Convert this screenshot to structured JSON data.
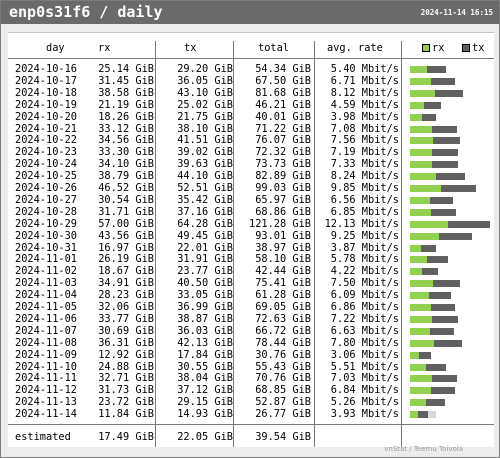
{
  "header": {
    "title": "enp0s31f6 / daily",
    "timestamp": "2024-11-14 16:15"
  },
  "columns": {
    "day": "day",
    "rx": "rx",
    "tx": "tx",
    "total": "total",
    "avg_rate": "avg. rate"
  },
  "legend": {
    "rx_label": "rx",
    "tx_label": "tx",
    "rx_icon": "green-square-icon",
    "tx_icon": "grey-square-icon"
  },
  "colors": {
    "rx": "#92d050",
    "tx": "#606060",
    "estimate": "#d8d8d8",
    "header": "#6a6a6a"
  },
  "rows": [
    {
      "day": "2024-10-16",
      "rx": "25.14 GiB",
      "tx": "29.20 GiB",
      "total": "54.34 GiB",
      "rate": "5.40 Mbit/s"
    },
    {
      "day": "2024-10-17",
      "rx": "31.45 GiB",
      "tx": "36.05 GiB",
      "total": "67.50 GiB",
      "rate": "6.71 Mbit/s"
    },
    {
      "day": "2024-10-18",
      "rx": "38.58 GiB",
      "tx": "43.10 GiB",
      "total": "81.68 GiB",
      "rate": "8.12 Mbit/s"
    },
    {
      "day": "2024-10-19",
      "rx": "21.19 GiB",
      "tx": "25.02 GiB",
      "total": "46.21 GiB",
      "rate": "4.59 Mbit/s"
    },
    {
      "day": "2024-10-20",
      "rx": "18.26 GiB",
      "tx": "21.75 GiB",
      "total": "40.01 GiB",
      "rate": "3.98 Mbit/s"
    },
    {
      "day": "2024-10-21",
      "rx": "33.12 GiB",
      "tx": "38.10 GiB",
      "total": "71.22 GiB",
      "rate": "7.08 Mbit/s"
    },
    {
      "day": "2024-10-22",
      "rx": "34.56 GiB",
      "tx": "41.51 GiB",
      "total": "76.07 GiB",
      "rate": "7.56 Mbit/s"
    },
    {
      "day": "2024-10-23",
      "rx": "33.30 GiB",
      "tx": "39.02 GiB",
      "total": "72.32 GiB",
      "rate": "7.19 Mbit/s"
    },
    {
      "day": "2024-10-24",
      "rx": "34.10 GiB",
      "tx": "39.63 GiB",
      "total": "73.73 GiB",
      "rate": "7.33 Mbit/s"
    },
    {
      "day": "2024-10-25",
      "rx": "38.79 GiB",
      "tx": "44.10 GiB",
      "total": "82.89 GiB",
      "rate": "8.24 Mbit/s"
    },
    {
      "day": "2024-10-26",
      "rx": "46.52 GiB",
      "tx": "52.51 GiB",
      "total": "99.03 GiB",
      "rate": "9.85 Mbit/s"
    },
    {
      "day": "2024-10-27",
      "rx": "30.54 GiB",
      "tx": "35.42 GiB",
      "total": "65.97 GiB",
      "rate": "6.56 Mbit/s"
    },
    {
      "day": "2024-10-28",
      "rx": "31.71 GiB",
      "tx": "37.16 GiB",
      "total": "68.86 GiB",
      "rate": "6.85 Mbit/s"
    },
    {
      "day": "2024-10-29",
      "rx": "57.00 GiB",
      "tx": "64.28 GiB",
      "total": "121.28 GiB",
      "rate": "12.13 Mbit/s"
    },
    {
      "day": "2024-10-30",
      "rx": "43.56 GiB",
      "tx": "49.45 GiB",
      "total": "93.01 GiB",
      "rate": "9.25 Mbit/s"
    },
    {
      "day": "2024-10-31",
      "rx": "16.97 GiB",
      "tx": "22.01 GiB",
      "total": "38.97 GiB",
      "rate": "3.87 Mbit/s"
    },
    {
      "day": "2024-11-01",
      "rx": "26.19 GiB",
      "tx": "31.91 GiB",
      "total": "58.10 GiB",
      "rate": "5.78 Mbit/s"
    },
    {
      "day": "2024-11-02",
      "rx": "18.67 GiB",
      "tx": "23.77 GiB",
      "total": "42.44 GiB",
      "rate": "4.22 Mbit/s"
    },
    {
      "day": "2024-11-03",
      "rx": "34.91 GiB",
      "tx": "40.50 GiB",
      "total": "75.41 GiB",
      "rate": "7.50 Mbit/s"
    },
    {
      "day": "2024-11-04",
      "rx": "28.23 GiB",
      "tx": "33.05 GiB",
      "total": "61.28 GiB",
      "rate": "6.09 Mbit/s"
    },
    {
      "day": "2024-11-05",
      "rx": "32.06 GiB",
      "tx": "36.99 GiB",
      "total": "69.05 GiB",
      "rate": "6.86 Mbit/s"
    },
    {
      "day": "2024-11-06",
      "rx": "33.77 GiB",
      "tx": "38.87 GiB",
      "total": "72.63 GiB",
      "rate": "7.22 Mbit/s"
    },
    {
      "day": "2024-11-07",
      "rx": "30.69 GiB",
      "tx": "36.03 GiB",
      "total": "66.72 GiB",
      "rate": "6.63 Mbit/s"
    },
    {
      "day": "2024-11-08",
      "rx": "36.31 GiB",
      "tx": "42.13 GiB",
      "total": "78.44 GiB",
      "rate": "7.80 Mbit/s"
    },
    {
      "day": "2024-11-09",
      "rx": "12.92 GiB",
      "tx": "17.84 GiB",
      "total": "30.76 GiB",
      "rate": "3.06 Mbit/s"
    },
    {
      "day": "2024-11-10",
      "rx": "24.88 GiB",
      "tx": "30.55 GiB",
      "total": "55.43 GiB",
      "rate": "5.51 Mbit/s"
    },
    {
      "day": "2024-11-11",
      "rx": "32.71 GiB",
      "tx": "38.04 GiB",
      "total": "70.76 GiB",
      "rate": "7.03 Mbit/s"
    },
    {
      "day": "2024-11-12",
      "rx": "31.73 GiB",
      "tx": "37.12 GiB",
      "total": "68.85 GiB",
      "rate": "6.84 Mbit/s"
    },
    {
      "day": "2024-11-13",
      "rx": "23.72 GiB",
      "tx": "29.15 GiB",
      "total": "52.87 GiB",
      "rate": "5.26 Mbit/s"
    },
    {
      "day": "2024-11-14",
      "rx": "11.84 GiB",
      "tx": "14.93 GiB",
      "total": "26.77 GiB",
      "rate": "3.93 Mbit/s",
      "estimated_total": 39.54
    }
  ],
  "estimated": {
    "label": "estimated",
    "rx": "17.49 GiB",
    "tx": "22.05 GiB",
    "total": "39.54 GiB"
  },
  "footer": {
    "credit": "vnStat / Teemu Toivola"
  }
}
